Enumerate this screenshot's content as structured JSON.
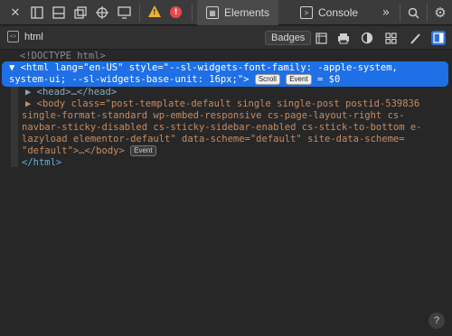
{
  "toolbar": {
    "tabs": [
      {
        "label": "Elements"
      },
      {
        "label": "Console"
      }
    ],
    "overflow_label": "»"
  },
  "subbar": {
    "breadcrumb": "html",
    "badges_label": "Badges"
  },
  "dom": {
    "doctype": "<!DOCTYPE html>",
    "html_line1": "▼ <html lang=\"en-US\" style=\"--sl-widgets-font-family: -apple-system,",
    "html_line2": "system-ui; --sl-widgets-base-unit: 16px;\">",
    "scroll_badge": "Scroll",
    "event_badge": "Event",
    "dollar": " = $0",
    "head_line": "▶ <head>…</head>",
    "body_line1": "▶ <body class=\"post-template-default single single-post postid-539836",
    "body_line2": "single-format-standard wp-embed-responsive cs-page-layout-right cs-",
    "body_line3": "navbar-sticky-disabled cs-sticky-sidebar-enabled cs-stick-to-bottom e-",
    "body_line4": "lazyload elementor-default\" data-scheme=\"default\" site-data-scheme=",
    "body_line5": "\"default\">…</body>",
    "body_event_badge": "Event",
    "html_close": "</html>"
  },
  "help_label": "?",
  "colors": {
    "selection": "#1f6fe6",
    "warning": "#e9b234",
    "error": "#e5484d"
  }
}
